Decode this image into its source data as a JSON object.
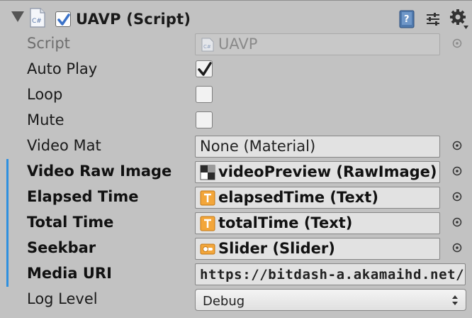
{
  "component": {
    "title": "UAVP (Script)",
    "enabled": true,
    "icons": [
      "foldout-arrow-icon",
      "csharp-script-icon",
      "help-book-icon",
      "preset-sliders-icon",
      "gear-icon"
    ]
  },
  "properties": [
    {
      "label": "Script",
      "value": "UAVP",
      "kind": "object-disabled"
    },
    {
      "label": "Auto Play",
      "kind": "toggle",
      "checked": true
    },
    {
      "label": "Loop",
      "kind": "toggle",
      "checked": false
    },
    {
      "label": "Mute",
      "kind": "toggle",
      "checked": false
    },
    {
      "label": "Video Mat",
      "value": "None (Material)",
      "kind": "object"
    },
    {
      "label": "Video Raw Image",
      "value": "videoPreview (RawImage)",
      "kind": "object",
      "icon": "raw-image-icon"
    },
    {
      "label": "Elapsed Time",
      "value": "elapsedTime (Text)",
      "kind": "object",
      "icon": "text-icon"
    },
    {
      "label": "Total Time",
      "value": "totalTime (Text)",
      "kind": "object",
      "icon": "text-icon"
    },
    {
      "label": "Seekbar",
      "value": "Slider (Slider)",
      "kind": "object",
      "icon": "slider-icon"
    },
    {
      "label": "Media URI",
      "value": "https://bitdash-a.akamaihd.net/c",
      "kind": "text"
    },
    {
      "label": "Log Level",
      "value": "Debug",
      "kind": "enum"
    }
  ],
  "colors": {
    "background": "#c2c2c2",
    "modified_bar": "#2e90e0",
    "check_blue": "#3b72c8"
  }
}
